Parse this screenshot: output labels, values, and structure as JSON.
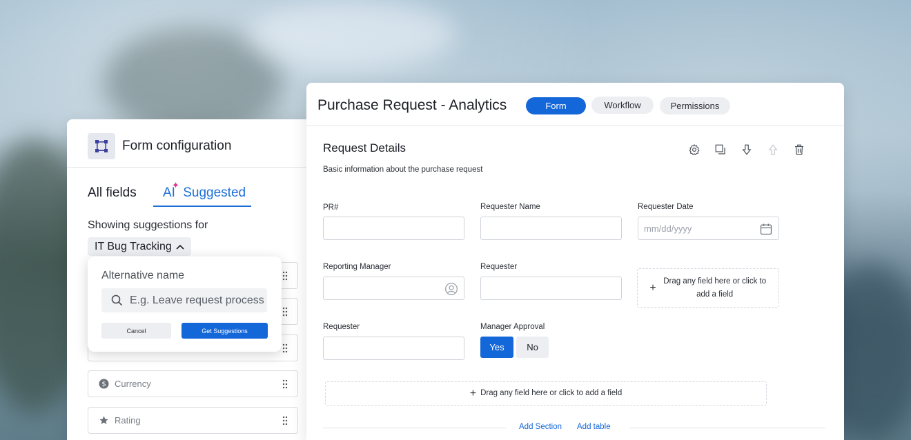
{
  "left_panel": {
    "title": "Form configuration",
    "tabs": {
      "all": "All fields",
      "ai_prefix": "AI",
      "suggested": "Suggested"
    },
    "showing_label": "Showing suggestions for",
    "dropdown_value": "IT Bug Tracking",
    "fields": [
      {
        "label": "",
        "icon": "drag-grip-icon"
      },
      {
        "label": "",
        "icon": "drag-grip-icon"
      },
      {
        "label": "",
        "icon": "drag-grip-icon"
      },
      {
        "label": "Currency",
        "icon": "dollar-icon"
      },
      {
        "label": "Rating",
        "icon": "star-icon"
      }
    ]
  },
  "popover": {
    "title": "Alternative name",
    "search_placeholder": "E.g. Leave request process",
    "cancel_label": "Cancel",
    "get_label": "Get Suggestions"
  },
  "right_panel": {
    "title": "Purchase Request - Analytics",
    "tabs": [
      "Form",
      "Workflow",
      "Permissions"
    ],
    "section_title": "Request Details",
    "section_desc": "Basic information about the purchase request",
    "fields": {
      "pr": "PR#",
      "requester_name": "Requester Name",
      "requester_date": "Requester Date",
      "date_placeholder": "mm/dd/yyyy",
      "reporting_manager": "Reporting Manager",
      "requester_1": "Requester",
      "requester_2": "Requester",
      "manager_approval": "Manager Approval"
    },
    "yes": "Yes",
    "no": "No",
    "dropzone_small": "Drag any field here or click to add a field",
    "dropzone_wide": "Drag any field here or click to add a field",
    "add_section": "Add Section",
    "add_table": "Add table"
  },
  "colors": {
    "accent": "#1467d9",
    "ai_sparkle": "#e0338e"
  }
}
